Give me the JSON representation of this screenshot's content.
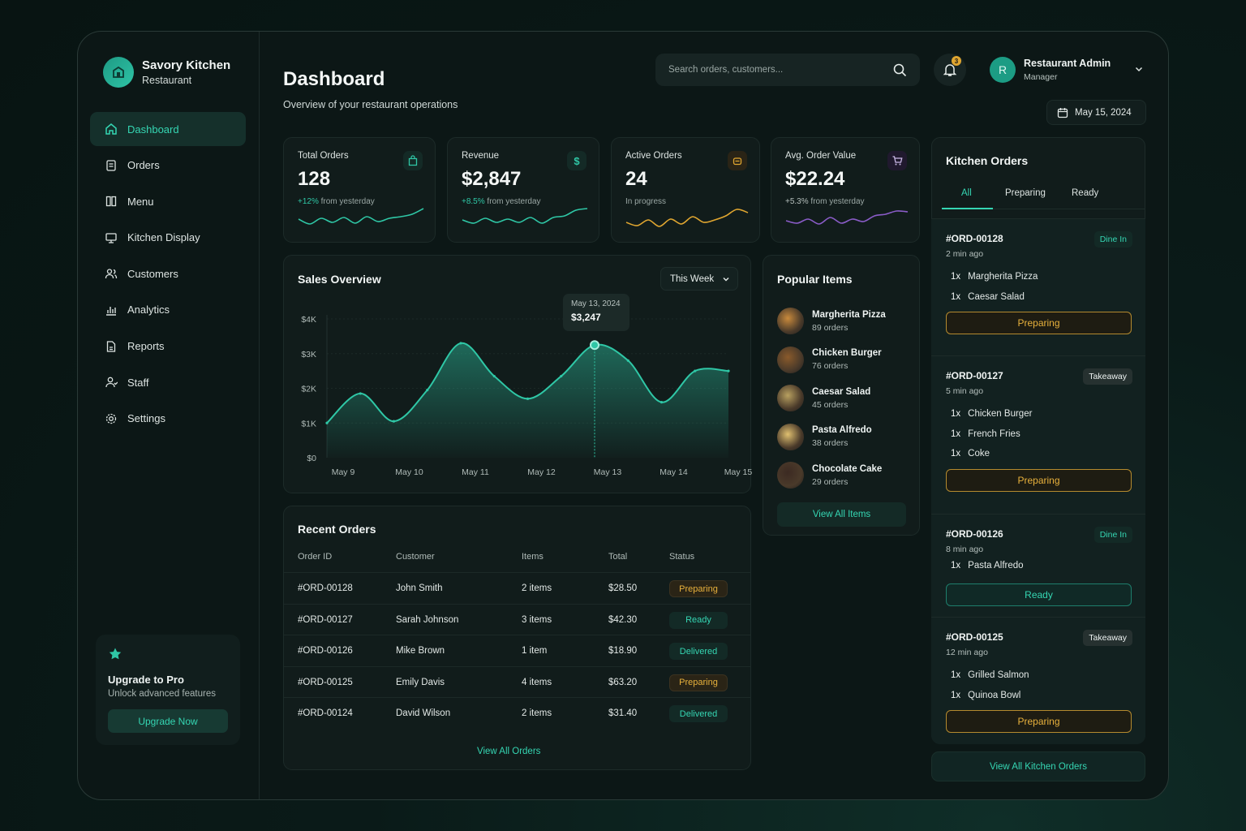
{
  "brand": {
    "title": "Savory Kitchen",
    "subtitle": "Restaurant"
  },
  "nav": [
    {
      "label": "Dashboard",
      "icon": "home-icon",
      "active": true
    },
    {
      "label": "Orders",
      "icon": "orders-icon"
    },
    {
      "label": "Menu",
      "icon": "menu-icon"
    },
    {
      "label": "Kitchen Display",
      "icon": "monitor-icon"
    },
    {
      "label": "Customers",
      "icon": "users-icon"
    },
    {
      "label": "Analytics",
      "icon": "analytics-icon"
    },
    {
      "label": "Reports",
      "icon": "report-icon"
    },
    {
      "label": "Staff",
      "icon": "staff-icon"
    },
    {
      "label": "Settings",
      "icon": "gear-icon"
    }
  ],
  "upgrade": {
    "title": "Upgrade to Pro",
    "subtitle": "Unlock advanced features",
    "button": "Upgrade Now"
  },
  "header": {
    "title": "Dashboard",
    "subtitle": "Overview of your restaurant operations",
    "search_placeholder": "Search orders, customers...",
    "notification_count": "3",
    "user_initial": "R",
    "user_name": "Restaurant Admin",
    "user_role": "Manager",
    "date": "May 15, 2024"
  },
  "stats": [
    {
      "label": "Total Orders",
      "value": "128",
      "change": "+12%",
      "suffix": " from yesterday",
      "icon": "bag-icon",
      "color": "#2fc7a6"
    },
    {
      "label": "Revenue",
      "value": "$2,847",
      "change": "+8.5%",
      "suffix": " from yesterday",
      "icon": "dollar-icon",
      "color": "#2fc7a6"
    },
    {
      "label": "Active Orders",
      "value": "24",
      "change": "",
      "suffix": "In progress",
      "icon": "cook-icon",
      "color": "#e0a630"
    },
    {
      "label": "Avg. Order Value",
      "value": "$22.24",
      "change": "+5.3%",
      "suffix": " from yesterday",
      "icon": "cart-icon",
      "color": "#8a5cc8"
    }
  ],
  "sales": {
    "title": "Sales Overview",
    "range_label": "This Week",
    "tooltip_date": "May 13, 2024",
    "tooltip_value": "$3,247"
  },
  "chart_data": {
    "type": "area",
    "x": [
      "May 9",
      "",
      "May 10",
      "",
      "May 11",
      "",
      "May 12",
      "",
      "May 13",
      "",
      "May 14",
      "",
      "May 15"
    ],
    "categories": [
      "May 9",
      "May 10",
      "May 11",
      "May 12",
      "May 13",
      "May 14",
      "May 15"
    ],
    "series": [
      {
        "values": [
          1000,
          1850,
          1050,
          1950,
          3300,
          2350,
          1700,
          2350,
          3247,
          2800,
          1600,
          2500,
          2500
        ]
      }
    ],
    "yticks": [
      "$0",
      "$1K",
      "$2K",
      "$3K",
      "$4K"
    ],
    "ylim": [
      0,
      4000
    ],
    "highlight_index": 8,
    "color": "#2fc7a6"
  },
  "recent": {
    "title": "Recent Orders",
    "columns": [
      "Order ID",
      "Customer",
      "Items",
      "Total",
      "Status"
    ],
    "rows": [
      {
        "id": "#ORD-00128",
        "customer": "John Smith",
        "items": "2 items",
        "total": "$28.50",
        "status": "Preparing"
      },
      {
        "id": "#ORD-00127",
        "customer": "Sarah Johnson",
        "items": "3 items",
        "total": "$42.30",
        "status": "Ready"
      },
      {
        "id": "#ORD-00126",
        "customer": "Mike Brown",
        "items": "1 item",
        "total": "$18.90",
        "status": "Delivered"
      },
      {
        "id": "#ORD-00125",
        "customer": "Emily Davis",
        "items": "4 items",
        "total": "$63.20",
        "status": "Preparing"
      },
      {
        "id": "#ORD-00124",
        "customer": "David Wilson",
        "items": "2 items",
        "total": "$31.40",
        "status": "Delivered"
      }
    ],
    "view_all": "View All Orders"
  },
  "popular": {
    "title": "Popular Items",
    "items": [
      {
        "name": "Margherita Pizza",
        "orders": "89 orders",
        "color": "#c98a3c"
      },
      {
        "name": "Chicken Burger",
        "orders": "76 orders",
        "color": "#8a5a2b"
      },
      {
        "name": "Caesar Salad",
        "orders": "45 orders",
        "color": "#b8a060"
      },
      {
        "name": "Pasta Alfredo",
        "orders": "38 orders",
        "color": "#e0c070"
      },
      {
        "name": "Chocolate Cake",
        "orders": "29 orders",
        "color": "#3c2a22"
      }
    ],
    "view_all": "View All Items"
  },
  "kitchen": {
    "title": "Kitchen Orders",
    "tabs": [
      "All",
      "Preparing",
      "Ready"
    ],
    "orders": [
      {
        "id": "#ORD-00128",
        "time": "2 min ago",
        "tag": "Dine In",
        "items": [
          {
            "qty": "1x",
            "name": "Margherita Pizza"
          },
          {
            "qty": "1x",
            "name": "Caesar Salad"
          }
        ],
        "action": "Preparing"
      },
      {
        "id": "#ORD-00127",
        "time": "5 min ago",
        "tag": "Takeaway",
        "items": [
          {
            "qty": "1x",
            "name": "Chicken Burger"
          },
          {
            "qty": "1x",
            "name": "French Fries"
          },
          {
            "qty": "1x",
            "name": "Coke"
          }
        ],
        "action": "Preparing"
      },
      {
        "id": "#ORD-00126",
        "time": "8 min ago",
        "tag": "Dine In",
        "items": [
          {
            "qty": "1x",
            "name": "Pasta Alfredo"
          }
        ],
        "action": "Ready"
      },
      {
        "id": "#ORD-00125",
        "time": "12 min ago",
        "tag": "Takeaway",
        "items": [
          {
            "qty": "1x",
            "name": "Grilled Salmon"
          },
          {
            "qty": "1x",
            "name": "Quinoa Bowl"
          }
        ],
        "action": "Preparing"
      }
    ],
    "view_all": "View All Kitchen Orders"
  }
}
